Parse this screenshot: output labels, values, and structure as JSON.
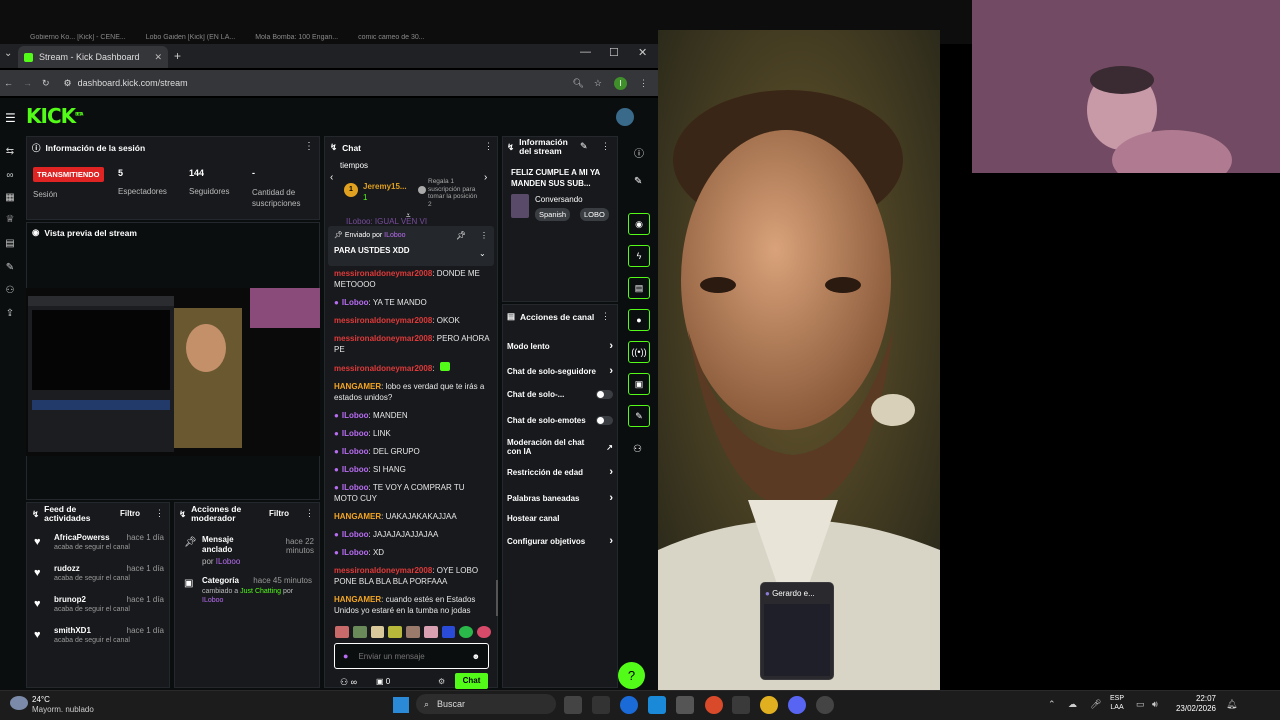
{
  "browser": {
    "bg_tabs": [
      "Gobierno Ko... [Kick] - CENE...",
      "Lobo Gaiden [Kick] (EN LA...",
      "Mola Bomba: 100 Engan...",
      "comic cameo de 30..."
    ],
    "tab_title": "Stream - Kick Dashboard",
    "url": "dashboard.kick.com/stream",
    "profile_initial": "I"
  },
  "kick": {
    "logo": "KICK",
    "beta": "BETA",
    "session": {
      "title": "Información de la sesión",
      "status": "TRANSMITIENDO",
      "session_label": "Sesión",
      "viewers": "5",
      "viewers_label": "Espectadores",
      "followers": "144",
      "followers_label": "Seguidores",
      "subs": "-",
      "subs_label": "Cantidad de suscripciones"
    },
    "preview": {
      "title": "Vista previa del stream"
    },
    "feed": {
      "title": "Feed de actividades",
      "filter": "Filtro",
      "items": [
        {
          "name": "AfricaPowerss",
          "time": "hace 1 día",
          "desc": "acaba de seguir el canal"
        },
        {
          "name": "rudozz",
          "time": "hace 1 día",
          "desc": "acaba de seguir el canal"
        },
        {
          "name": "brunop2",
          "time": "hace 1 día",
          "desc": "acaba de seguir el canal"
        },
        {
          "name": "smithXD1",
          "time": "hace 1 día",
          "desc": "acaba de seguir el canal"
        }
      ]
    },
    "modactions": {
      "title": "Acciones de moderador",
      "filter": "Filtro",
      "items": [
        {
          "title": "Mensaje anclado",
          "time": "hace 22 minutos",
          "by_prefix": "por",
          "by": "ILoboo"
        },
        {
          "title": "Categoría",
          "time": "hace 45 minutos",
          "detail_prefix": "cambiado a",
          "category": "Just Chatting",
          "by_prefix": "por",
          "by": "ILoboo"
        }
      ]
    },
    "chat": {
      "title": "Chat",
      "tiempos": "tiempos",
      "top_user": "Jeremy15...",
      "top_rank": "1",
      "top_count": "1",
      "gift_text": "Regala 1 suscripción para tomar la posición 2",
      "cut_line": "ILoboo: IGUAL VEN VI",
      "pinned": {
        "sent_by": "Enviado por",
        "user": "ILoboo",
        "message": "PARA USTDES XDD"
      },
      "messages": [
        {
          "user": "messironaldoneymar2008",
          "color": "red",
          "text": "DONDE ME METOOOO"
        },
        {
          "user": "ILoboo",
          "color": "pur",
          "text": "YA TE MANDO"
        },
        {
          "user": "messironaldoneymar2008",
          "color": "red",
          "text": "OKOK"
        },
        {
          "user": "messironaldoneymar2008",
          "color": "red",
          "text": "PERO AHORA PE"
        },
        {
          "user": "messironaldoneymar2008",
          "color": "red",
          "text": ""
        },
        {
          "user": "HANGAMER",
          "color": "org",
          "text": "lobo es verdad que te irás a estados unidos?"
        },
        {
          "user": "ILoboo",
          "color": "pur",
          "text": "MANDEN"
        },
        {
          "user": "ILoboo",
          "color": "pur",
          "text": "LINK"
        },
        {
          "user": "ILoboo",
          "color": "pur",
          "text": "DEL GRUPO"
        },
        {
          "user": "ILoboo",
          "color": "pur",
          "text": "SI HANG"
        },
        {
          "user": "ILoboo",
          "color": "pur",
          "text": "TE VOY A COMPRAR TU MOTO CUY"
        },
        {
          "user": "HANGAMER",
          "color": "org",
          "text": "UAKAJAKAKAJJAA"
        },
        {
          "user": "ILoboo",
          "color": "pur",
          "text": "JAJAJAJAJJAJAA"
        },
        {
          "user": "ILoboo",
          "color": "pur",
          "text": "XD"
        },
        {
          "user": "messironaldoneymar2008",
          "color": "red",
          "text": "OYE LOBO PONE BLA BLA BLA PORFAAA"
        },
        {
          "user": "HANGAMER",
          "color": "org",
          "text": "cuando estés en Estados Unidos yo estaré en la tumba no jodas"
        }
      ],
      "input_placeholder": "Enviar un mensaje",
      "points": "0",
      "send": "Chat",
      "infinity": "∞"
    },
    "streaminfo": {
      "title": "Información del stream",
      "stream_title": "FELIZ CUMPLE A MI YA MANDEN SUS SUB...",
      "category": "Conversando",
      "tags": [
        "Spanish",
        "LOBO"
      ]
    },
    "channel": {
      "title": "Acciones de canal",
      "items": [
        {
          "label": "Modo lento",
          "kind": "arrow"
        },
        {
          "label": "Chat de solo-seguidore",
          "kind": "arrow"
        },
        {
          "label": "Chat de solo-...",
          "kind": "toggle"
        },
        {
          "label": "Chat de solo-emotes",
          "kind": "toggle"
        },
        {
          "label": "Moderación del chat con IA",
          "kind": "ext"
        },
        {
          "label": "Restricción de edad",
          "kind": "arrow"
        },
        {
          "label": "Palabras baneadas",
          "kind": "arrow"
        },
        {
          "label": "Hostear canal",
          "kind": "none"
        },
        {
          "label": "Configurar objetivos",
          "kind": "arrow"
        }
      ]
    }
  },
  "popup": {
    "title": "Gerardo e..."
  },
  "taskbar": {
    "temp": "24°C",
    "weather": "Mayorm. nublado",
    "search": "Buscar",
    "lang1": "ESP",
    "lang2": "LAA",
    "time": "22:07",
    "date": "23/02/2026"
  }
}
